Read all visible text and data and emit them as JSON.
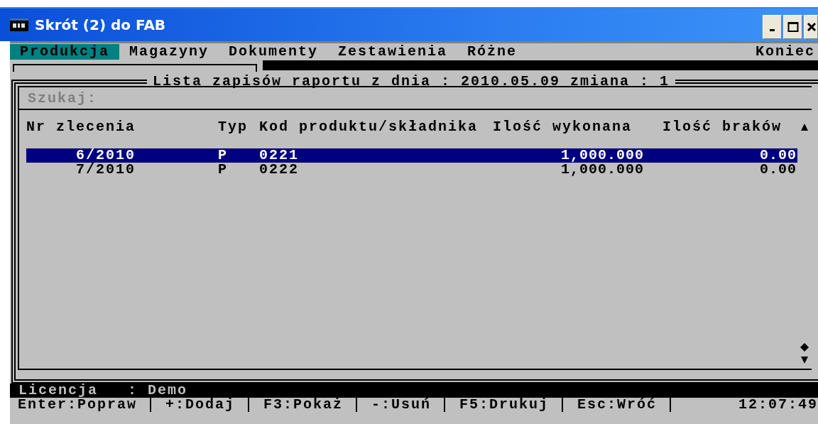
{
  "window": {
    "title": "Skrót (2) do FAB"
  },
  "menu": {
    "items": [
      {
        "label": "Produkcja",
        "selected": true,
        "kind": "menu"
      },
      {
        "label": "Magazyny",
        "selected": false,
        "kind": "menu"
      },
      {
        "label": "Dokumenty",
        "selected": false,
        "kind": "menu"
      },
      {
        "label": "Zestawienia",
        "selected": false,
        "kind": "menu"
      },
      {
        "label": "Różne",
        "selected": false,
        "kind": "menu"
      },
      {
        "label": "Koniec",
        "selected": false,
        "kind": "exit"
      }
    ]
  },
  "report": {
    "title": "Lista zapisów raportu z dnia : 2010.05.09 zmiana : 1",
    "search": {
      "label": "Szukaj:"
    },
    "table": {
      "columns": [
        "Nr zlecenia",
        "Typ",
        "Kod produktu/składnika",
        "Ilość wykonana",
        "Ilość braków"
      ],
      "rows": [
        {
          "cells": [
            "6/2010",
            "P",
            "0221",
            "1,000.000",
            "0.00"
          ],
          "selected": true
        },
        {
          "cells": [
            "7/2010",
            "P",
            "0222",
            "1,000.000",
            "0.00"
          ],
          "selected": false
        }
      ]
    }
  },
  "status_bar": {
    "text": "Licencja   : Demo"
  },
  "key_bar": {
    "keys": [
      "Enter:Popraw",
      "+:Dodaj",
      "F3:Pokaż",
      "-:Usuń",
      "F5:Drukuj",
      "Esc:Wróć"
    ],
    "clock": "12:07:49"
  }
}
